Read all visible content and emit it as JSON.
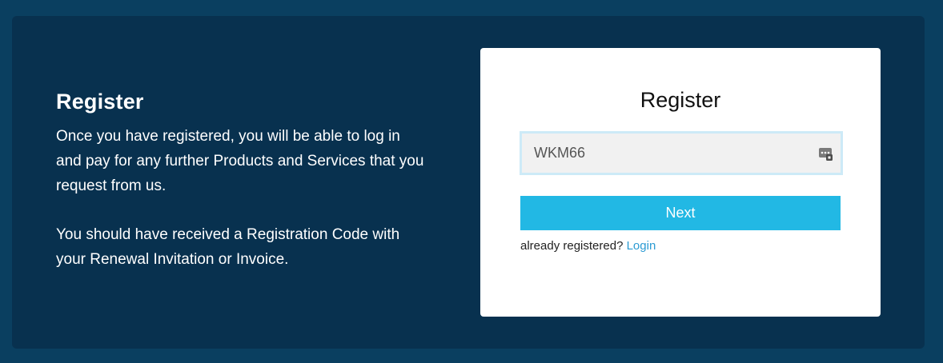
{
  "info": {
    "title": "Register",
    "paragraph1": "Once you have registered, you will be able to log in and pay for any further Products and Services that you request from us.",
    "paragraph2": "You should have received a Registration Code with your Renewal Invitation or Invoice."
  },
  "card": {
    "title": "Register",
    "code_value": "WKM66",
    "input_icon": "password-manager-key-icon",
    "next_label": "Next",
    "already_text": "already registered?",
    "login_label": "Login"
  },
  "colors": {
    "page_bg": "#0a3f60",
    "panel_bg": "#08314f",
    "button": "#22b8e4",
    "link": "#2b9bd3"
  }
}
